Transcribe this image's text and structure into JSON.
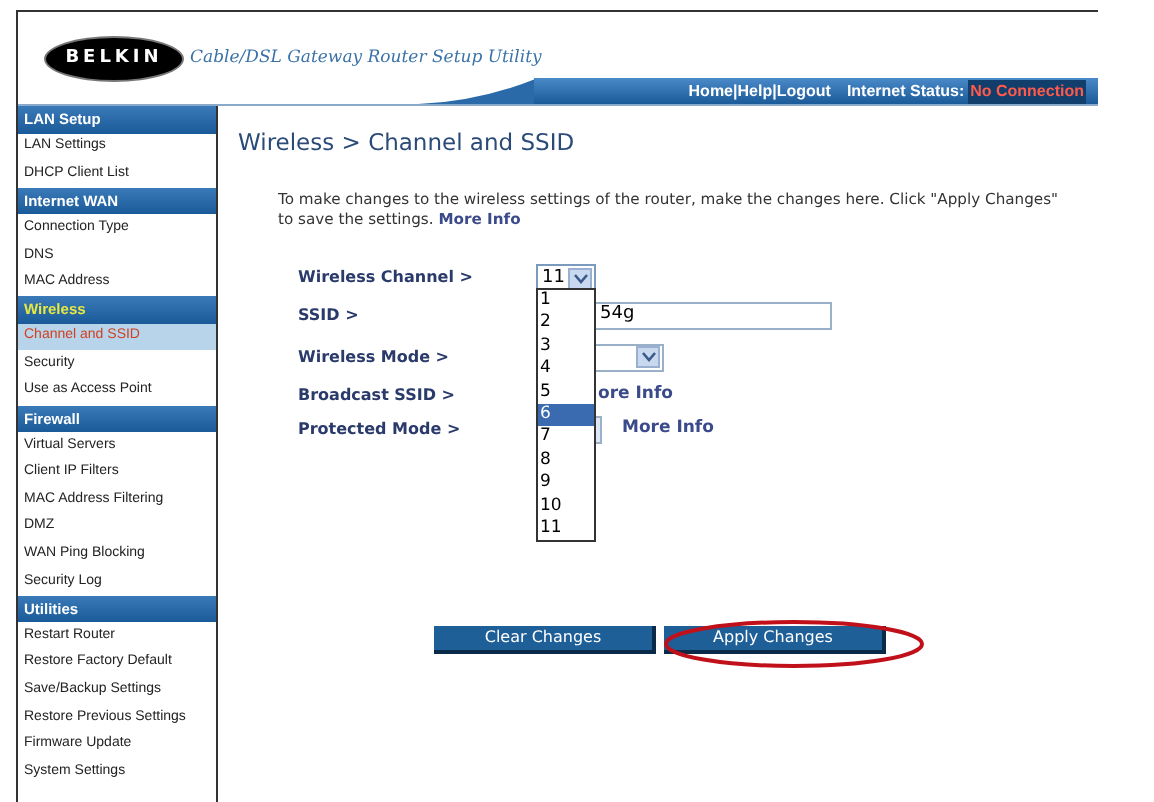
{
  "header": {
    "logo": "BELKIN",
    "title": "Cable/DSL Gateway Router Setup Utility",
    "links": [
      "Home|",
      "Help|",
      "Logout"
    ],
    "status_label": "Internet Status:",
    "status_value": "No Connection"
  },
  "sidebar": [
    {
      "heading": "LAN Setup",
      "selected": false,
      "items": [
        {
          "label": "LAN Settings",
          "selected": false
        },
        {
          "label": "DHCP Client List",
          "selected": false
        }
      ]
    },
    {
      "heading": "Internet WAN",
      "selected": false,
      "items": [
        {
          "label": "Connection Type",
          "selected": false
        },
        {
          "label": "DNS",
          "selected": false
        },
        {
          "label": "MAC Address",
          "selected": false
        }
      ]
    },
    {
      "heading": "Wireless",
      "selected": true,
      "items": [
        {
          "label": "Channel and SSID",
          "selected": true
        },
        {
          "label": "Security",
          "selected": false
        },
        {
          "label": "Use as Access Point",
          "selected": false
        }
      ]
    },
    {
      "heading": "Firewall",
      "selected": false,
      "items": [
        {
          "label": "Virtual Servers",
          "selected": false
        },
        {
          "label": "Client IP Filters",
          "selected": false
        },
        {
          "label": "MAC Address Filtering",
          "selected": false
        },
        {
          "label": "DMZ",
          "selected": false
        },
        {
          "label": "WAN Ping Blocking",
          "selected": false
        },
        {
          "label": "Security Log",
          "selected": false
        }
      ]
    },
    {
      "heading": "Utilities",
      "selected": false,
      "items": [
        {
          "label": "Restart Router",
          "selected": false
        },
        {
          "label": "Restore Factory Default",
          "selected": false
        },
        {
          "label": "Save/Backup Settings",
          "selected": false
        },
        {
          "label": "Restore Previous Settings",
          "selected": false
        },
        {
          "label": "Firmware Update",
          "selected": false
        },
        {
          "label": "System Settings",
          "selected": false
        }
      ]
    }
  ],
  "page_title": "Wireless > Channel and SSID",
  "intro": "To make changes to the wireless settings of the router, make the changes here. Click \"Apply Changes\" to save the settings.",
  "intro_link": "More Info",
  "form": [
    {
      "kind": "select",
      "label": "Wireless Channel >",
      "value": "11"
    },
    {
      "kind": "text",
      "label": "SSID >",
      "value": "54g"
    },
    {
      "kind": "select_partial",
      "label": "Wireless Mode >"
    },
    {
      "kind": "link",
      "label": "Broadcast SSID >",
      "link": "ore Info"
    },
    {
      "kind": "select_edge_link",
      "label": "Protected Mode >",
      "link": "More Info"
    }
  ],
  "channel_options": [
    {
      "label": "1",
      "selected": false
    },
    {
      "label": "2",
      "selected": false
    },
    {
      "label": "3",
      "selected": false
    },
    {
      "label": "4",
      "selected": false
    },
    {
      "label": "5",
      "selected": false
    },
    {
      "label": "6",
      "selected": true
    },
    {
      "label": "7",
      "selected": false
    },
    {
      "label": "8",
      "selected": false
    },
    {
      "label": "9",
      "selected": false
    },
    {
      "label": "10",
      "selected": false
    },
    {
      "label": "11",
      "selected": false
    }
  ],
  "buttons": [
    "Clear Changes",
    "Apply Changes"
  ]
}
